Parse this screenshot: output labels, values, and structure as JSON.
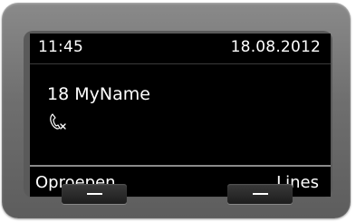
{
  "status": {
    "time": "11:45",
    "date": "18.08.2012"
  },
  "idle": {
    "handset_name": "18 MyName",
    "missed_call_icon": "missed-call-handset-icon"
  },
  "softkeys": {
    "left_label": "Oproepen",
    "right_label": "Lines"
  },
  "colors": {
    "screen_bg": "#000000",
    "text": "#ffffff",
    "device_body": "#707070"
  }
}
